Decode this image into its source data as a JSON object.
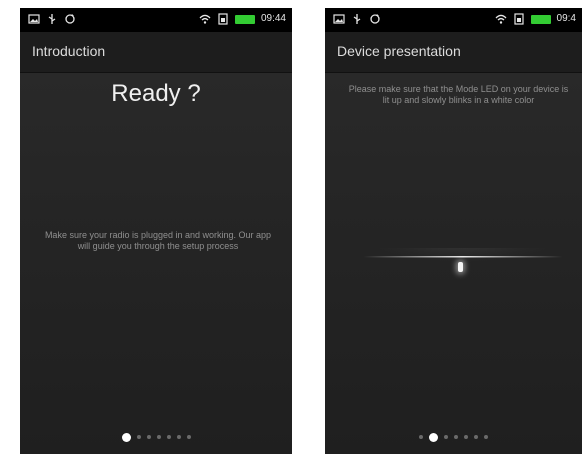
{
  "status_bar": {
    "time": "09:44",
    "time_right": "09:4"
  },
  "screens": [
    {
      "title": "Introduction",
      "heading": "Ready ?",
      "body_text": "Make sure your radio is plugged in and working. Our app will guide you through the setup process",
      "pager_count": 7,
      "pager_active": 0
    },
    {
      "title": "Device presentation",
      "body_text": "Please make sure that the Mode LED on your device is lit up and slowly blinks in a white color",
      "pager_count": 7,
      "pager_active": 1
    }
  ],
  "colors": {
    "background": "#252525",
    "status_bar": "#000000",
    "battery": "#33cc33",
    "text_primary": "#f0f0f0",
    "text_secondary": "#8f8f8f"
  },
  "icons": [
    "image-icon",
    "usb-icon",
    "sync-icon",
    "wifi-icon",
    "sim-icon",
    "battery-icon"
  ]
}
